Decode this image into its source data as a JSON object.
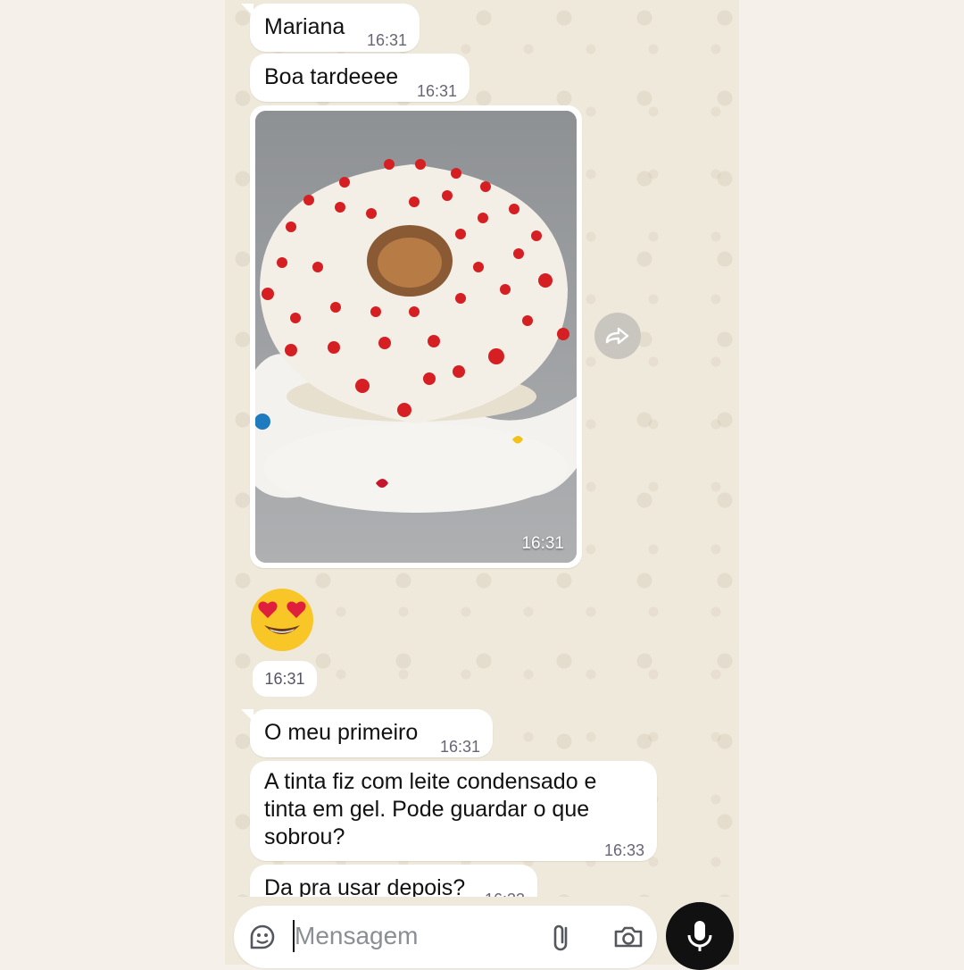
{
  "messages": [
    {
      "text": "Mariana",
      "time": "16:31"
    },
    {
      "text": "Boa tardeeee",
      "time": "16:31"
    },
    {
      "text": "O meu primeiro",
      "time": "16:31"
    },
    {
      "text": "A tinta fiz com leite condensado e tinta em gel. Pode guardar o que sobrou?",
      "time": "16:33"
    },
    {
      "text": "Da pra usar depois?",
      "time": "16:33"
    }
  ],
  "image_message": {
    "time": "16:31"
  },
  "emoji_message": {
    "emoji": "heart-eyes-emoji",
    "time": "16:31"
  },
  "composer": {
    "placeholder": "Mensagem"
  },
  "icons": {
    "sticker": "sticker-icon",
    "attach": "paperclip-icon",
    "camera": "camera-icon",
    "mic": "microphone-icon",
    "forward": "forward-icon"
  }
}
